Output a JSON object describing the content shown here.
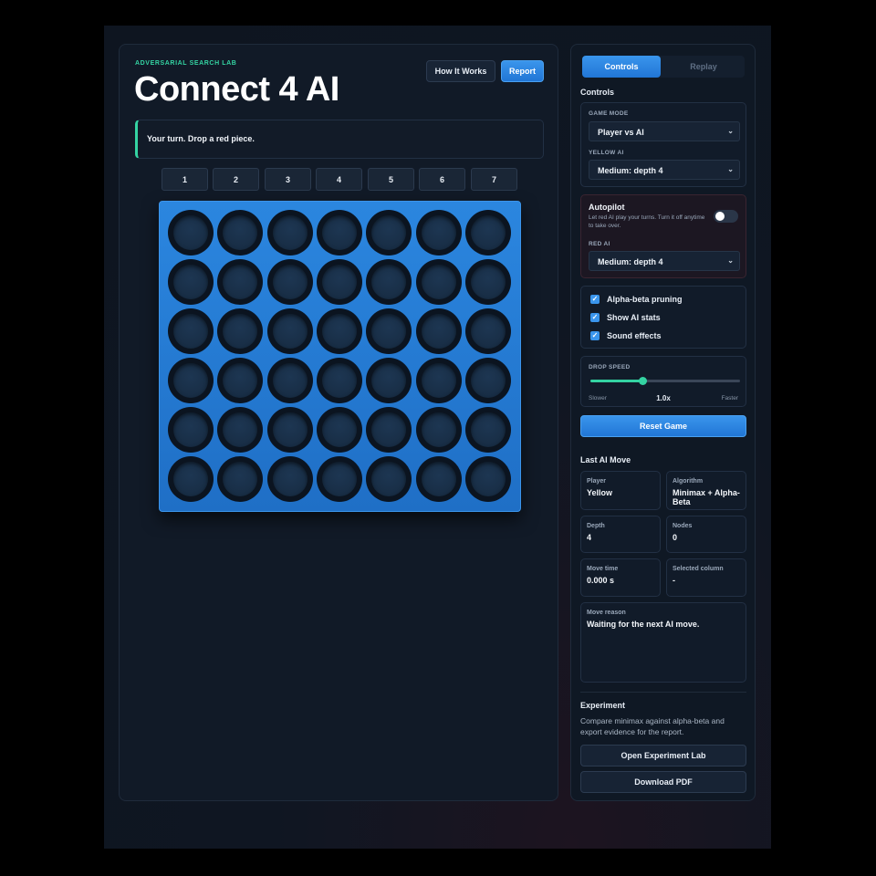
{
  "header": {
    "eyebrow": "ADVERSARIAL SEARCH LAB",
    "title": "Connect 4 AI",
    "how_it_works_label": "How It Works",
    "report_label": "Report"
  },
  "status_text": "Your turn. Drop a red piece.",
  "columns": [
    "1",
    "2",
    "3",
    "4",
    "5",
    "6",
    "7"
  ],
  "board": {
    "rows": 6,
    "cols": 7
  },
  "tabs": {
    "controls": "Controls",
    "replay": "Replay"
  },
  "controls": {
    "section_title": "Controls",
    "game_mode_label": "GAME MODE",
    "game_mode_value": "Player vs AI",
    "yellow_ai_label": "YELLOW AI",
    "yellow_ai_value": "Medium: depth 4",
    "autopilot_title": "Autopilot",
    "autopilot_desc": "Let red AI play your turns. Turn it off anytime to take over.",
    "red_ai_label": "RED AI",
    "red_ai_value": "Medium: depth 4",
    "checks": [
      "Alpha-beta pruning",
      "Show AI stats",
      "Sound effects"
    ],
    "drop_speed_label": "DROP SPEED",
    "drop_speed_fraction": 0.35,
    "slower_label": "Slower",
    "speed_value": "1.0x",
    "faster_label": "Faster",
    "reset_label": "Reset Game"
  },
  "last_move": {
    "title": "Last AI Move",
    "player_label": "Player",
    "player_value": "Yellow",
    "algorithm_label": "Algorithm",
    "algorithm_value": "Minimax + Alpha-Beta",
    "depth_label": "Depth",
    "depth_value": "4",
    "nodes_label": "Nodes",
    "nodes_value": "0",
    "time_label": "Move time",
    "time_value": "0.000 s",
    "column_label": "Selected column",
    "column_value": "-",
    "reason_label": "Move reason",
    "reason_value": "Waiting for the next AI move."
  },
  "experiment": {
    "title": "Experiment",
    "text": "Compare minimax against alpha-beta and export evidence for the report.",
    "open_label": "Open Experiment Lab",
    "pdf_label": "Download PDF"
  },
  "colors": {
    "accent": "#2f86e6",
    "teal": "#34d3a2",
    "board": "#2379d4"
  }
}
